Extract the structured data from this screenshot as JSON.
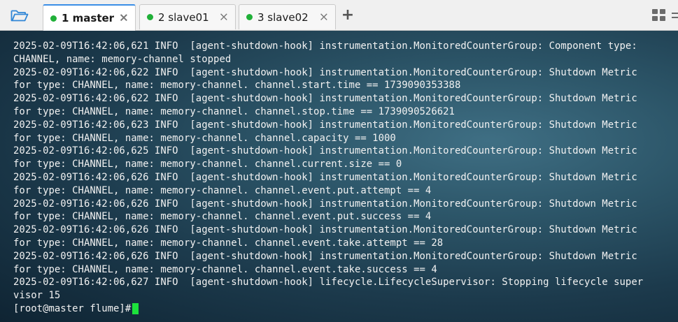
{
  "tabs": [
    {
      "number": "1",
      "name": "master",
      "active": true,
      "status_color": "#20b038"
    },
    {
      "number": "2",
      "name": "slave01",
      "active": false,
      "status_color": "#20b038"
    },
    {
      "number": "3",
      "name": "slave02",
      "active": false,
      "status_color": "#20b038"
    }
  ],
  "tab_labels": [
    "1 master",
    "2 slave01",
    "3 slave02"
  ],
  "tab_close_glyph": "×",
  "add_tab_glyph": "+",
  "icons": {
    "open_folder": "folder-open-icon",
    "grid": "grid-view-icon"
  },
  "colors": {
    "accent": "#3a8ee6",
    "cursor": "#1de23c",
    "terminal_text": "#f2f2f2",
    "folder_icon": "#2f86d6"
  },
  "terminal": {
    "lines": [
      "2025-02-09T16:42:06,621 INFO  [agent-shutdown-hook] instrumentation.MonitoredCounterGroup: Component type:",
      "CHANNEL, name: memory-channel stopped",
      "2025-02-09T16:42:06,622 INFO  [agent-shutdown-hook] instrumentation.MonitoredCounterGroup: Shutdown Metric",
      "for type: CHANNEL, name: memory-channel. channel.start.time == 1739090353388",
      "2025-02-09T16:42:06,622 INFO  [agent-shutdown-hook] instrumentation.MonitoredCounterGroup: Shutdown Metric",
      "for type: CHANNEL, name: memory-channel. channel.stop.time == 1739090526621",
      "2025-02-09T16:42:06,623 INFO  [agent-shutdown-hook] instrumentation.MonitoredCounterGroup: Shutdown Metric",
      "for type: CHANNEL, name: memory-channel. channel.capacity == 1000",
      "2025-02-09T16:42:06,625 INFO  [agent-shutdown-hook] instrumentation.MonitoredCounterGroup: Shutdown Metric",
      "for type: CHANNEL, name: memory-channel. channel.current.size == 0",
      "2025-02-09T16:42:06,626 INFO  [agent-shutdown-hook] instrumentation.MonitoredCounterGroup: Shutdown Metric",
      "for type: CHANNEL, name: memory-channel. channel.event.put.attempt == 4",
      "2025-02-09T16:42:06,626 INFO  [agent-shutdown-hook] instrumentation.MonitoredCounterGroup: Shutdown Metric",
      "for type: CHANNEL, name: memory-channel. channel.event.put.success == 4",
      "2025-02-09T16:42:06,626 INFO  [agent-shutdown-hook] instrumentation.MonitoredCounterGroup: Shutdown Metric",
      "for type: CHANNEL, name: memory-channel. channel.event.take.attempt == 28",
      "2025-02-09T16:42:06,626 INFO  [agent-shutdown-hook] instrumentation.MonitoredCounterGroup: Shutdown Metric",
      "for type: CHANNEL, name: memory-channel. channel.event.take.success == 4",
      "2025-02-09T16:42:06,627 INFO  [agent-shutdown-hook] lifecycle.LifecycleSupervisor: Stopping lifecycle super",
      "visor 15"
    ],
    "prompt": "[root@master flume]#"
  }
}
